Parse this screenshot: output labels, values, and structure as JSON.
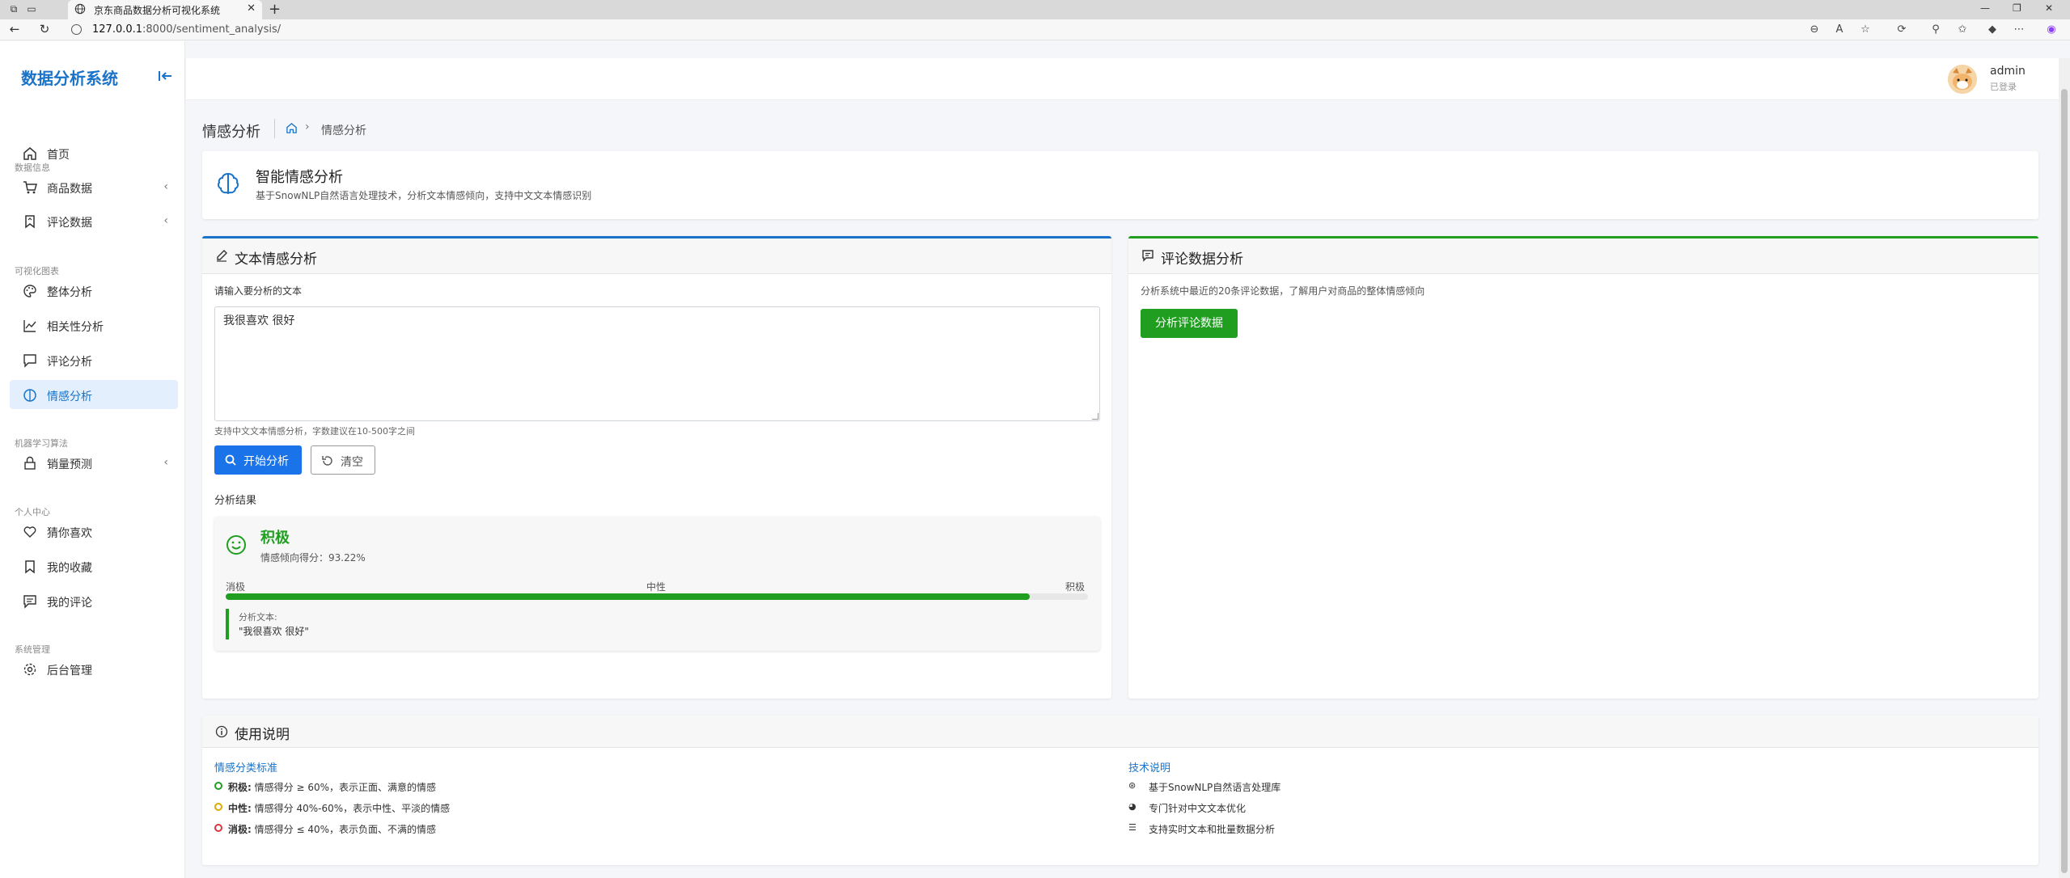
{
  "browser": {
    "tab_title": "京东商品数据分析可视化系统",
    "url_host": "127.0.0.1",
    "url_rest": ":8000/sentiment_analysis/"
  },
  "sidebar": {
    "brand": "数据分析系统",
    "items": [
      {
        "label": "首页"
      },
      {
        "label": "商品数据"
      },
      {
        "label": "评论数据"
      },
      {
        "label": "整体分析"
      },
      {
        "label": "相关性分析"
      },
      {
        "label": "评论分析"
      },
      {
        "label": "情感分析"
      },
      {
        "label": "销量预测"
      },
      {
        "label": "猜你喜欢"
      },
      {
        "label": "我的收藏"
      },
      {
        "label": "我的评论"
      },
      {
        "label": "后台管理"
      }
    ],
    "sections": [
      "数据信息",
      "可视化图表",
      "机器学习算法",
      "个人中心",
      "系统管理"
    ]
  },
  "header": {
    "user_name": "admin",
    "user_status": "已登录"
  },
  "page": {
    "title": "情感分析",
    "breadcrumb_current": "情感分析"
  },
  "intro": {
    "title": "智能情感分析",
    "desc": "基于SnowNLP自然语言处理技术，分析文本情感倾向，支持中文文本情感识别"
  },
  "text_panel": {
    "title": "文本情感分析",
    "input_label": "请输入要分析的文本",
    "input_value": "我很喜欢 很好",
    "hint": "支持中文文本情感分析，字数建议在10-500字之间",
    "analyze_btn": "开始分析",
    "clear_btn": "清空",
    "result_label": "分析结果",
    "result": {
      "sentiment": "积极",
      "score_text": "情感倾向得分：93.22%",
      "score": 0.9322,
      "scale_left": "消极",
      "scale_mid": "中性",
      "scale_right": "积极",
      "quote_label": "分析文本:",
      "quote_text": "\"我很喜欢 很好\""
    }
  },
  "review_panel": {
    "title": "评论数据分析",
    "desc": "分析系统中最近的20条评论数据，了解用户对商品的整体情感倾向",
    "btn": "分析评论数据"
  },
  "usage": {
    "title": "使用说明",
    "left_title": "情感分类标准",
    "left_items": [
      {
        "key": "积极:",
        "text": "情感得分 ≥ 60%，表示正面、满意的情感",
        "color": "#1f9e1f"
      },
      {
        "key": "中性:",
        "text": "情感得分 40%-60%，表示中性、平淡的情感",
        "color": "#e0a800"
      },
      {
        "key": "消极:",
        "text": "情感得分 ≤ 40%，表示负面、不满的情感",
        "color": "#d9363e"
      }
    ],
    "right_title": "技术说明",
    "right_items": [
      {
        "text": "基于SnowNLP自然语言处理库"
      },
      {
        "text": "专门针对中文文本优化"
      },
      {
        "text": "支持实时文本和批量数据分析"
      }
    ]
  },
  "colors": {
    "primary": "#1a73e8",
    "brand": "#1a73c8",
    "success": "#1f9e1f"
  }
}
